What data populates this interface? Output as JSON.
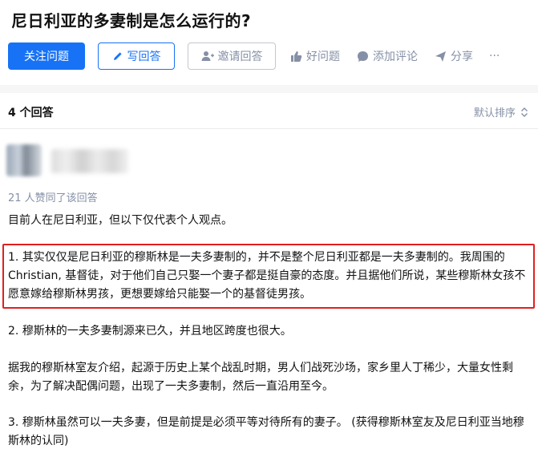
{
  "question": {
    "title": "尼日利亚的多妻制是怎么运行的?"
  },
  "actions": {
    "follow": "关注问题",
    "write": "写回答",
    "invite": "邀请回答",
    "good": "好问题",
    "comment": "添加评论",
    "share": "分享",
    "more": "···"
  },
  "answers": {
    "count": "4 个回答",
    "sort": "默认排序"
  },
  "answer": {
    "votes": "21 人赞同了该回答",
    "paragraphs": [
      "目前人在尼日利亚，但以下仅代表个人观点。",
      "1. 其实仅仅是尼日利亚的穆斯林是一夫多妻制的，并不是整个尼日利亚都是一夫多妻制的。我周围的Christian, 基督徒，对于他们自己只娶一个妻子都是挺自豪的态度。并且据他们所说，某些穆斯林女孩不愿意嫁给穆斯林男孩，更想要嫁给只能娶一个的基督徒男孩。",
      "2. 穆斯林的一夫多妻制源来已久，并且地区跨度也很大。",
      "据我的穆斯林室友介绍，起源于历史上某个战乱时期，男人们战死沙场，家乡里人丁稀少，大量女性剩余，为了解决配偶问题，出现了一夫多妻制，然后一直沿用至今。",
      "3. 穆斯林虽然可以一夫多妻，但是前提是必须平等对待所有的妻子。  (获得穆斯林室友及尼日利亚当地穆斯林的认同)"
    ]
  },
  "colors": {
    "primary": "#1772f6",
    "muted": "#8590a6",
    "highlight_border": "#e02020"
  }
}
